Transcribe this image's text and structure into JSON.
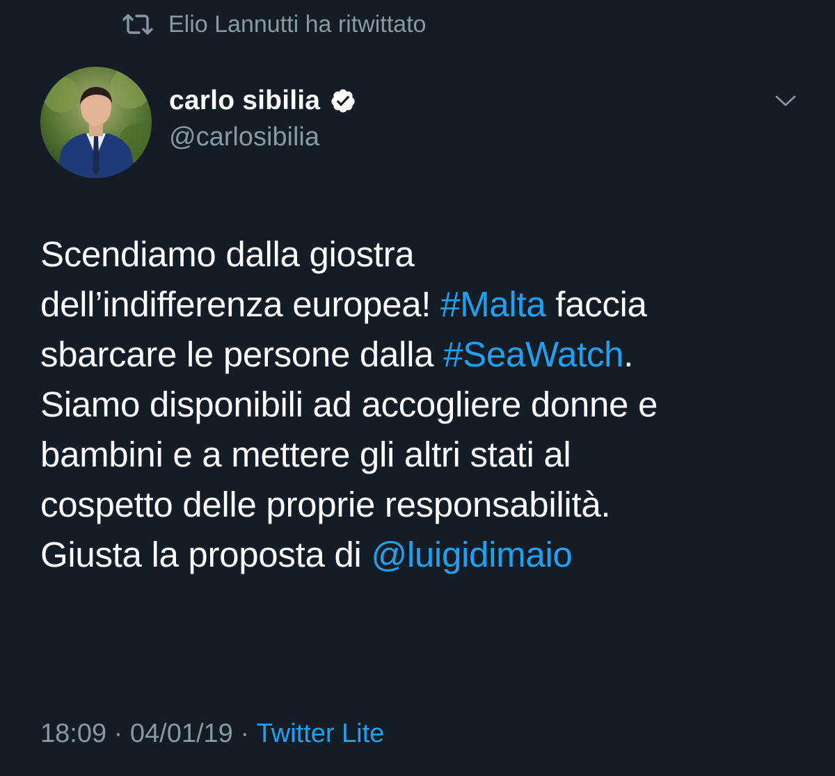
{
  "retweet": {
    "text": "Elio Lannutti ha ritwittato",
    "icon": "retweet-icon"
  },
  "author": {
    "name": "carlo sibilia",
    "handle": "@carlosibilia",
    "verified": true,
    "avatar": "avatar"
  },
  "tweet": {
    "lines": [
      [
        {
          "text": "Scendiamo dalla giostra",
          "link": false
        }
      ],
      [
        {
          "text": "dell’indifferenza europea! ",
          "link": false
        },
        {
          "text": "#Malta",
          "link": true
        },
        {
          "text": " faccia",
          "link": false
        }
      ],
      [
        {
          "text": "sbarcare le persone dalla ",
          "link": false
        },
        {
          "text": "#SeaWatch",
          "link": true
        },
        {
          "text": ".",
          "link": false
        }
      ],
      [
        {
          "text": "Siamo disponibili ad accogliere donne e",
          "link": false
        }
      ],
      [
        {
          "text": "bambini e a mettere gli altri stati al",
          "link": false
        }
      ],
      [
        {
          "text": "cospetto delle proprie responsabilità.",
          "link": false
        }
      ],
      [
        {
          "text": "Giusta la proposta di ",
          "link": false
        },
        {
          "text": "@luigidimaio",
          "link": true
        }
      ]
    ]
  },
  "meta": {
    "time": "18:09",
    "sep1": " · ",
    "date": "04/01/19",
    "sep2": " · ",
    "source": "Twitter Lite"
  },
  "colors": {
    "background": "#141d26",
    "text": "#ffffff",
    "secondary": "#8899a6",
    "link": "#1da1f2"
  }
}
